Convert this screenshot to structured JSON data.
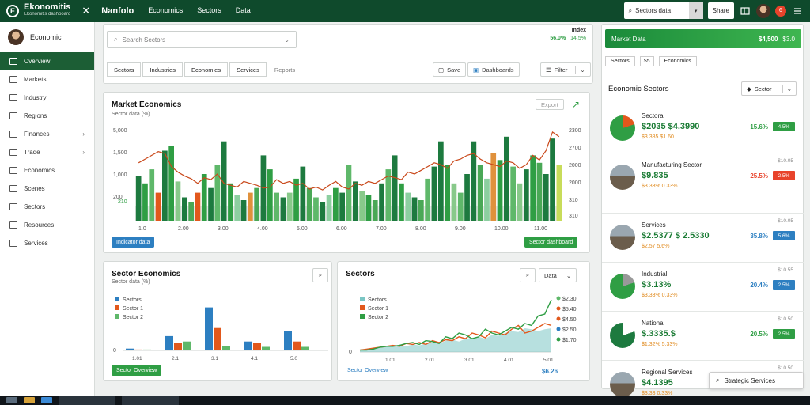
{
  "topbar": {
    "logo_glyph": "E",
    "logo_title": "Ekonomitis",
    "logo_subtitle": "Ekonomitis dashboard",
    "close_glyph": "✕",
    "brand": "Nanfolo",
    "nav": [
      "Economics",
      "Sectors",
      "Data"
    ],
    "search_value": "Sectors data",
    "search_dropdown": "▾",
    "action_label": "Share",
    "notif_count": "6"
  },
  "sidebar": {
    "user": "Economic",
    "items": [
      {
        "label": "Overview",
        "active": true
      },
      {
        "label": "Markets"
      },
      {
        "label": "Industry"
      },
      {
        "label": "Regions"
      },
      {
        "label": "Finances",
        "chevron": "›"
      },
      {
        "label": "Trade",
        "chevron": "›"
      },
      {
        "label": "Economics"
      },
      {
        "label": "Scenes"
      },
      {
        "label": "Sectors"
      },
      {
        "label": "Resources"
      },
      {
        "label": "Services"
      }
    ]
  },
  "controls": {
    "search_placeholder": "Search Sectors",
    "search_chevron": "⌄",
    "kpi_label": "Index",
    "kpi_values": [
      "56.0%",
      "14.5%"
    ],
    "tabs": [
      "Sectors",
      "Industries",
      "Economies",
      "Services",
      "Reports"
    ],
    "btn_save": "Save",
    "btn_dashboard": "Dashboards",
    "btn_filter": "Filter",
    "filter_chevron": "⌄"
  },
  "main_chart": {
    "title": "Market Economics",
    "subtitle": "Sector data (%)",
    "export_label": "Export",
    "btn_left": "Indicator data",
    "btn_right": "Sector dashboard",
    "trend_glyph": "↗",
    "chart_data": {
      "type": "bar",
      "title": "Market Economics",
      "y_ticks_left": [
        "5,000",
        "1,500",
        "1,000",
        "200"
      ],
      "y_ticks_right": [
        "2300",
        "2700",
        "2000",
        "2000",
        "310"
      ],
      "x_ticks": [
        "1.0",
        "2.00",
        "3.00",
        "4.00",
        "5.00",
        "6.00",
        "7.00",
        "8.00",
        "9.00",
        "10.00",
        "11.00"
      ],
      "ylim": [
        0,
        100
      ],
      "values": [
        48,
        40,
        55,
        30,
        75,
        80,
        42,
        25,
        20,
        30,
        50,
        35,
        60,
        85,
        40,
        28,
        22,
        30,
        35,
        70,
        55,
        30,
        25,
        30,
        45,
        58,
        35,
        25,
        20,
        28,
        35,
        30,
        60,
        42,
        32,
        28,
        22,
        40,
        55,
        70,
        40,
        30,
        25,
        22,
        45,
        58,
        85,
        60,
        40,
        30,
        50,
        85,
        60,
        45,
        72,
        65,
        90,
        58,
        40,
        55,
        70,
        62,
        50,
        88,
        60
      ],
      "colors": [
        "#1d7a3f",
        "#2f9e44",
        "#5fb86a",
        "#e2581c",
        "#1d7a3f",
        "#2f9e44",
        "#88c98a",
        "#1d7a3f",
        "#4aa856",
        "#e2581c",
        "#2f9e44",
        "#1d7a3f",
        "#5fb86a",
        "#1d7a3f",
        "#2f9e44",
        "#8ccfa0",
        "#1d7a3f",
        "#e0913c",
        "#4aa856",
        "#1d7a3f",
        "#2f9e44",
        "#5fb86a",
        "#1d7a3f",
        "#88c98a",
        "#2f9e44",
        "#1d7a3f",
        "#4aa856",
        "#5fb86a",
        "#1d7a3f",
        "#8ccfa0",
        "#2f9e44",
        "#1d7a3f",
        "#5fb86a",
        "#1d7a3f",
        "#88c98a",
        "#2f9e44",
        "#4aa856",
        "#1d7a3f",
        "#5fb86a",
        "#1d7a3f",
        "#2f9e44",
        "#8ccfa0",
        "#1d7a3f",
        "#4aa856",
        "#5fb86a",
        "#1d7a3f",
        "#1d7a3f",
        "#2f9e44",
        "#88c98a",
        "#5fb86a",
        "#1d7a3f",
        "#1d7a3f",
        "#4aa856",
        "#8ccfa0",
        "#e0913c",
        "#2f9e44",
        "#1d7a3f",
        "#5fb86a",
        "#88c98a",
        "#1d7a3f",
        "#2f9e44",
        "#4aa856",
        "#1d7a3f",
        "#1d7a3f",
        "#c8dc5a"
      ],
      "line": [
        62,
        66,
        70,
        74,
        72,
        58,
        52,
        48,
        45,
        40,
        46,
        44,
        50,
        40,
        38,
        36,
        42,
        40,
        38,
        35,
        36,
        44,
        40,
        42,
        38,
        40,
        34,
        36,
        33,
        38,
        42,
        36,
        34,
        40,
        38,
        42,
        40,
        44,
        48,
        46,
        44,
        52,
        50,
        54,
        58,
        62,
        60,
        56,
        64,
        66,
        70,
        72,
        66,
        62,
        60,
        58,
        64,
        62,
        56,
        60,
        70,
        65,
        75,
        95,
        90
      ],
      "axis_label_left": "210",
      "axis_label_right": "310"
    }
  },
  "sector_panel": {
    "title": "Sector Economics",
    "subtitle": "Sector data (%)",
    "search_glyph": "⌕",
    "legend": [
      "Sectors",
      "Sector 1",
      "Sector 2"
    ],
    "zero_label": "0",
    "x_ticks": [
      "1.01",
      "2.1",
      "3.1",
      "4.1",
      "5.0"
    ],
    "btn": "Sector Overview",
    "chart_data": {
      "type": "bar",
      "categories": [
        "1.01",
        "2.1",
        "3.1",
        "4.1",
        "5.0"
      ],
      "series": [
        {
          "name": "Sectors",
          "color": "#2d7fc1",
          "values": [
            2,
            16,
            48,
            10,
            22
          ]
        },
        {
          "name": "Sector 1",
          "color": "#e2581c",
          "values": [
            1,
            8,
            25,
            8,
            10
          ]
        },
        {
          "name": "Sector 2",
          "color": "#5fb86a",
          "values": [
            1,
            10,
            5,
            4,
            4
          ]
        }
      ],
      "ylim": [
        0,
        60
      ]
    }
  },
  "secondary_panel": {
    "title": "Sectors",
    "search_glyph": "⌕",
    "btn": "Data",
    "btn_chevron": "⌄",
    "legend": [
      "Sectors",
      "Sector 1",
      "Sector 2"
    ],
    "right_values": [
      "$2.30",
      "$5.40",
      "$4.50",
      "$2.50",
      "$1.70"
    ],
    "x_ticks": [
      "1.01",
      "2.01",
      "3.01",
      "4.01",
      "5.01"
    ],
    "zero_label": "0",
    "footer_left": "Sector Overview",
    "footer_right": "$6.26",
    "chart_data": {
      "type": "area",
      "x": [
        0,
        1,
        2,
        3,
        4,
        5,
        6,
        7,
        8,
        9,
        10,
        11,
        12,
        13,
        14,
        15,
        16,
        17,
        18,
        19,
        20,
        21,
        22,
        23,
        24,
        25,
        26,
        27,
        28,
        29
      ],
      "series": [
        {
          "name": "Sectors",
          "color": "#7bc6c4",
          "values": [
            2,
            3,
            4,
            5,
            6,
            6,
            7,
            6,
            8,
            7,
            9,
            10,
            9,
            12,
            13,
            11,
            14,
            15,
            16,
            14,
            18,
            17,
            20,
            22,
            21,
            25,
            24,
            22,
            24,
            25
          ]
        },
        {
          "name": "Sector 1",
          "color": "#e2581c",
          "values": [
            2,
            3,
            4,
            5,
            6,
            7,
            6,
            9,
            8,
            10,
            8,
            12,
            10,
            13,
            12,
            16,
            14,
            20,
            18,
            15,
            22,
            20,
            18,
            24,
            28,
            20,
            22,
            26,
            30,
            28
          ]
        },
        {
          "name": "Sector 2",
          "color": "#2f9e44",
          "values": [
            2,
            2,
            3,
            5,
            6,
            6,
            7,
            9,
            10,
            8,
            12,
            11,
            9,
            16,
            14,
            20,
            18,
            14,
            16,
            24,
            20,
            18,
            22,
            26,
            24,
            30,
            28,
            38,
            40,
            55
          ]
        }
      ],
      "ylim": [
        0,
        60
      ]
    }
  },
  "right_panel": {
    "header_title": "Market Data",
    "header_values": [
      "$4,500",
      "$3.0"
    ],
    "subtabs": [
      "Sectors",
      "$5",
      "Economics"
    ],
    "section_title": "Economic Sectors",
    "dropdown_value": "Sector",
    "dropdown_chevron": "⌄",
    "items": [
      {
        "name": "Sectoral",
        "value": "$2035 $4.3990",
        "sub": "$3.385 $1.60",
        "pct": "15.6%",
        "badge": "4.5%",
        "meta": "",
        "thumb": "pie",
        "c1": "#e2581c",
        "c2": "#2f9e44",
        "color": "green"
      },
      {
        "name": "Manufacturing Sector",
        "value": "$9.835",
        "sub": "$3.33% 0.33%",
        "pct": "25.5%",
        "badge": "2.5%",
        "meta": "$10.05",
        "thumb": "photo",
        "color": "red"
      },
      {
        "name": "Services",
        "value": "$2.5377 $ 2.5330",
        "sub": "$2.57 5.6%",
        "pct": "35.8%",
        "badge": "5.6%",
        "meta": "$10.05",
        "thumb": "photo",
        "color": "blue"
      },
      {
        "name": "Industrial",
        "value": "$3.13%",
        "sub": "$3.33% 0.33%",
        "pct": "20.4%",
        "badge": "2.5%",
        "meta": "$10.55",
        "thumb": "pie",
        "c1": "#999",
        "c2": "#2f9e44",
        "color": "blue"
      },
      {
        "name": "National",
        "value": "$.3335.$",
        "sub": "$1.32% 5.33%",
        "pct": "20.5%",
        "badge": "2.5%",
        "meta": "$10.50",
        "thumb": "pie",
        "c1": "#fff",
        "c2": "#1d7a3f",
        "color": "green"
      },
      {
        "name": "Regional Services",
        "value": "$4.1395",
        "sub": "$3.33 0.33%",
        "pct": "19.5%",
        "badge": "4.5%",
        "meta": "$10.50",
        "thumb": "photo",
        "color": "green"
      }
    ],
    "search_box": "Strategic Services"
  },
  "colors": {
    "brand": "#0f4a2c",
    "accent": "#2f9e44",
    "orange": "#e2581c",
    "blue": "#2d7fc1"
  }
}
